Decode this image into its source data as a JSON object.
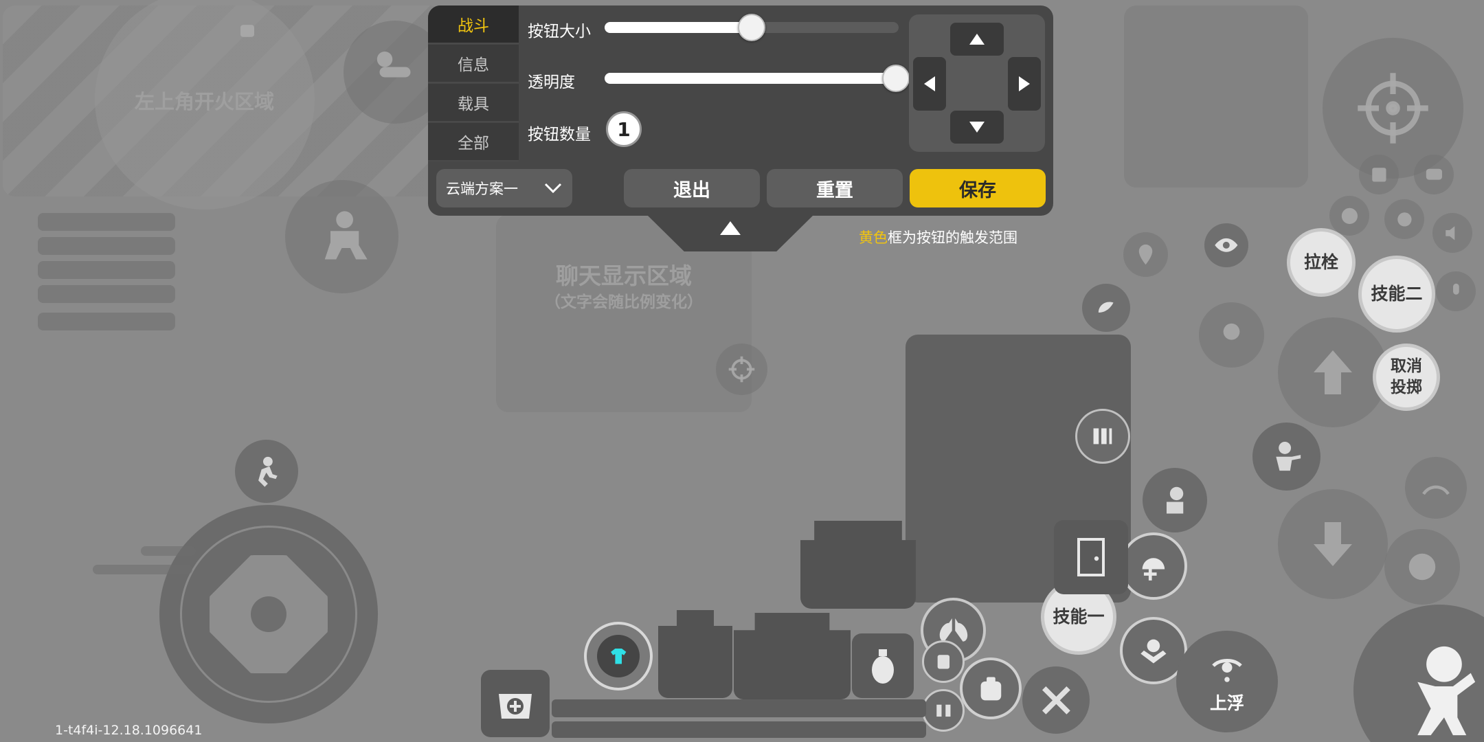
{
  "panel": {
    "tabs": [
      "战斗",
      "信息",
      "载具",
      "全部"
    ],
    "active_tab": "战斗",
    "size_label": "按钮大小",
    "size_value": 0.5,
    "opacity_label": "透明度",
    "opacity_value": 1.0,
    "count_label": "按钮数量",
    "count_value": "1",
    "scheme": "云端方案一",
    "exit_label": "退出",
    "reset_label": "重置",
    "save_label": "保存"
  },
  "hint": {
    "highlight": "黄色",
    "rest": "框为按钮的触发范围"
  },
  "zones": {
    "top_left_fire": "左上角开火区域",
    "chat_title": "聊天显示区域",
    "chat_sub": "（文字会随比例变化）"
  },
  "buttons": {
    "bolt": "拉栓",
    "skill_two": "技能二",
    "cancel_throw_1": "取消",
    "cancel_throw_2": "投掷",
    "skill_one": "技能一",
    "float_up": "上浮"
  },
  "version": "1-t4f4i-12.18.1096641",
  "colors": {
    "accent": "#f1c40f",
    "save": "#eec20d",
    "panel": "#474747"
  }
}
